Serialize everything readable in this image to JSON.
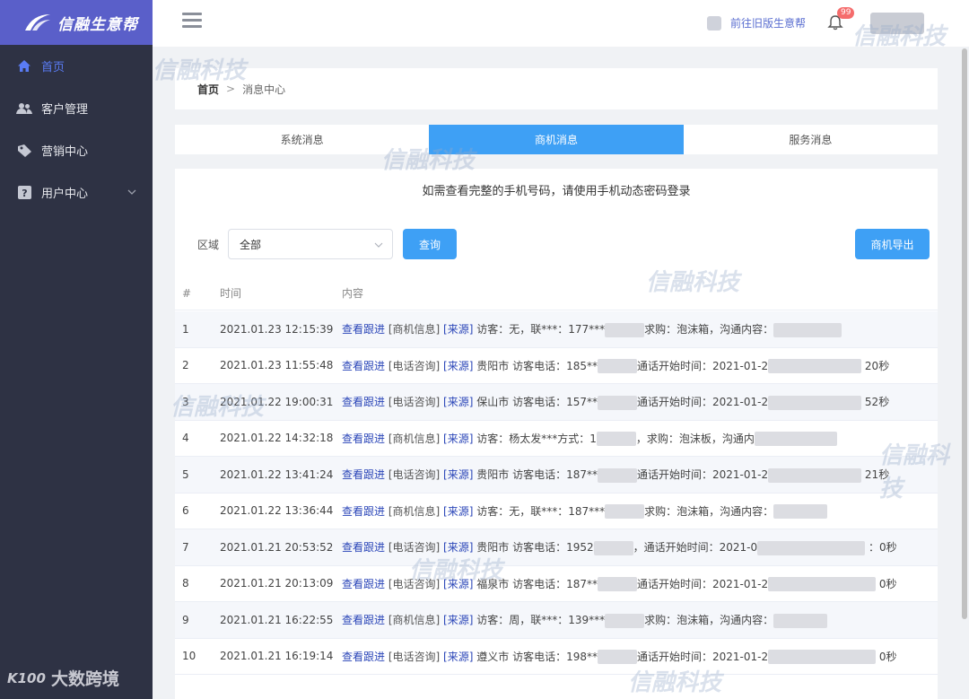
{
  "app": {
    "logo_text": "信融生意帮",
    "brand_color": "#5a5fc9",
    "sidebar_color": "#2e3244",
    "accent_color": "#3ea0f5"
  },
  "sidebar": {
    "items": [
      {
        "label": "首页",
        "icon": "home-icon"
      },
      {
        "label": "客户管理",
        "icon": "users-icon"
      },
      {
        "label": "营销中心",
        "icon": "tag-icon"
      },
      {
        "label": "用户中心",
        "icon": "help-icon"
      }
    ]
  },
  "watermark_corner": {
    "mini": "K100",
    "text": "大数跨境"
  },
  "watermark_text": "信融科技",
  "topbar": {
    "old_version_link": "前往旧版生意帮",
    "notification_count": "99"
  },
  "breadcrumb": {
    "home": "首页",
    "separator": ">",
    "current": "消息中心"
  },
  "tabs": [
    {
      "label": "系统消息",
      "active": false
    },
    {
      "label": "商机消息",
      "active": true
    },
    {
      "label": "服务消息",
      "active": false
    }
  ],
  "notice": "如需查看完整的手机号码，请使用手机动态密码登录",
  "filter": {
    "region_label": "区域",
    "region_value": "全部",
    "query_button": "查询",
    "export_button": "商机导出"
  },
  "table": {
    "headers": [
      "#",
      "时间",
      "内容"
    ],
    "rows": [
      {
        "idx": "1",
        "time": "2021.01.23 12:15:39",
        "link": "查看跟进",
        "tag": "[商机信息]",
        "source": "[来源]",
        "text_a": "访客：无，联***：177***",
        "text_b": "求购：泡沫箱，沟通内容：",
        "tail": ""
      },
      {
        "idx": "2",
        "time": "2021.01.23 11:55:48",
        "link": "查看跟进",
        "tag": "[电话咨询]",
        "source": "[来源]",
        "text_a": "贵阳市 访客电话：185**",
        "text_b": "通话开始时间：2021-01-2",
        "tail": "20秒"
      },
      {
        "idx": "3",
        "time": "2021.01.22 19:00:31",
        "link": "查看跟进",
        "tag": "[电话咨询]",
        "source": "[来源]",
        "text_a": "保山市 访客电话：157**",
        "text_b": "通话开始时间：2021-01-2",
        "tail": "52秒"
      },
      {
        "idx": "4",
        "time": "2021.01.22 14:32:18",
        "link": "查看跟进",
        "tag": "[商机信息]",
        "source": "[来源]",
        "text_a": "访客：杨太发***方式：1",
        "text_b": "，求购：泡沫板，沟通内",
        "tail": ""
      },
      {
        "idx": "5",
        "time": "2021.01.22 13:41:24",
        "link": "查看跟进",
        "tag": "[电话咨询]",
        "source": "[来源]",
        "text_a": "贵阳市 访客电话：187**",
        "text_b": "通话开始时间：2021-01-2",
        "tail": "21秒"
      },
      {
        "idx": "6",
        "time": "2021.01.22 13:36:44",
        "link": "查看跟进",
        "tag": "[商机信息]",
        "source": "[来源]",
        "text_a": "访客：无，联***：187***",
        "text_b": "求购：泡沫箱，沟通内容：",
        "tail": ""
      },
      {
        "idx": "7",
        "time": "2021.01.21 20:53:52",
        "link": "查看跟进",
        "tag": "[电话咨询]",
        "source": "[来源]",
        "text_a": "贵阳市 访客电话：1952",
        "text_b": "，通话开始时间：2021-0",
        "tail": "：0秒"
      },
      {
        "idx": "8",
        "time": "2021.01.21 20:13:09",
        "link": "查看跟进",
        "tag": "[电话咨询]",
        "source": "[来源]",
        "text_a": "福泉市 访客电话：187**",
        "text_b": "通话开始时间：2021-01-2",
        "tail": "0秒"
      },
      {
        "idx": "9",
        "time": "2021.01.21 16:22:55",
        "link": "查看跟进",
        "tag": "[商机信息]",
        "source": "[来源]",
        "text_a": "访客：周，联***：139***",
        "text_b": "求购：泡沫箱，沟通内容：",
        "tail": ""
      },
      {
        "idx": "10",
        "time": "2021.01.21 16:19:14",
        "link": "查看跟进",
        "tag": "[电话咨询]",
        "source": "[来源]",
        "text_a": "遵义市 访客电话：198**",
        "text_b": "通话开始时间：2021-01-2",
        "tail": "0秒"
      }
    ]
  }
}
